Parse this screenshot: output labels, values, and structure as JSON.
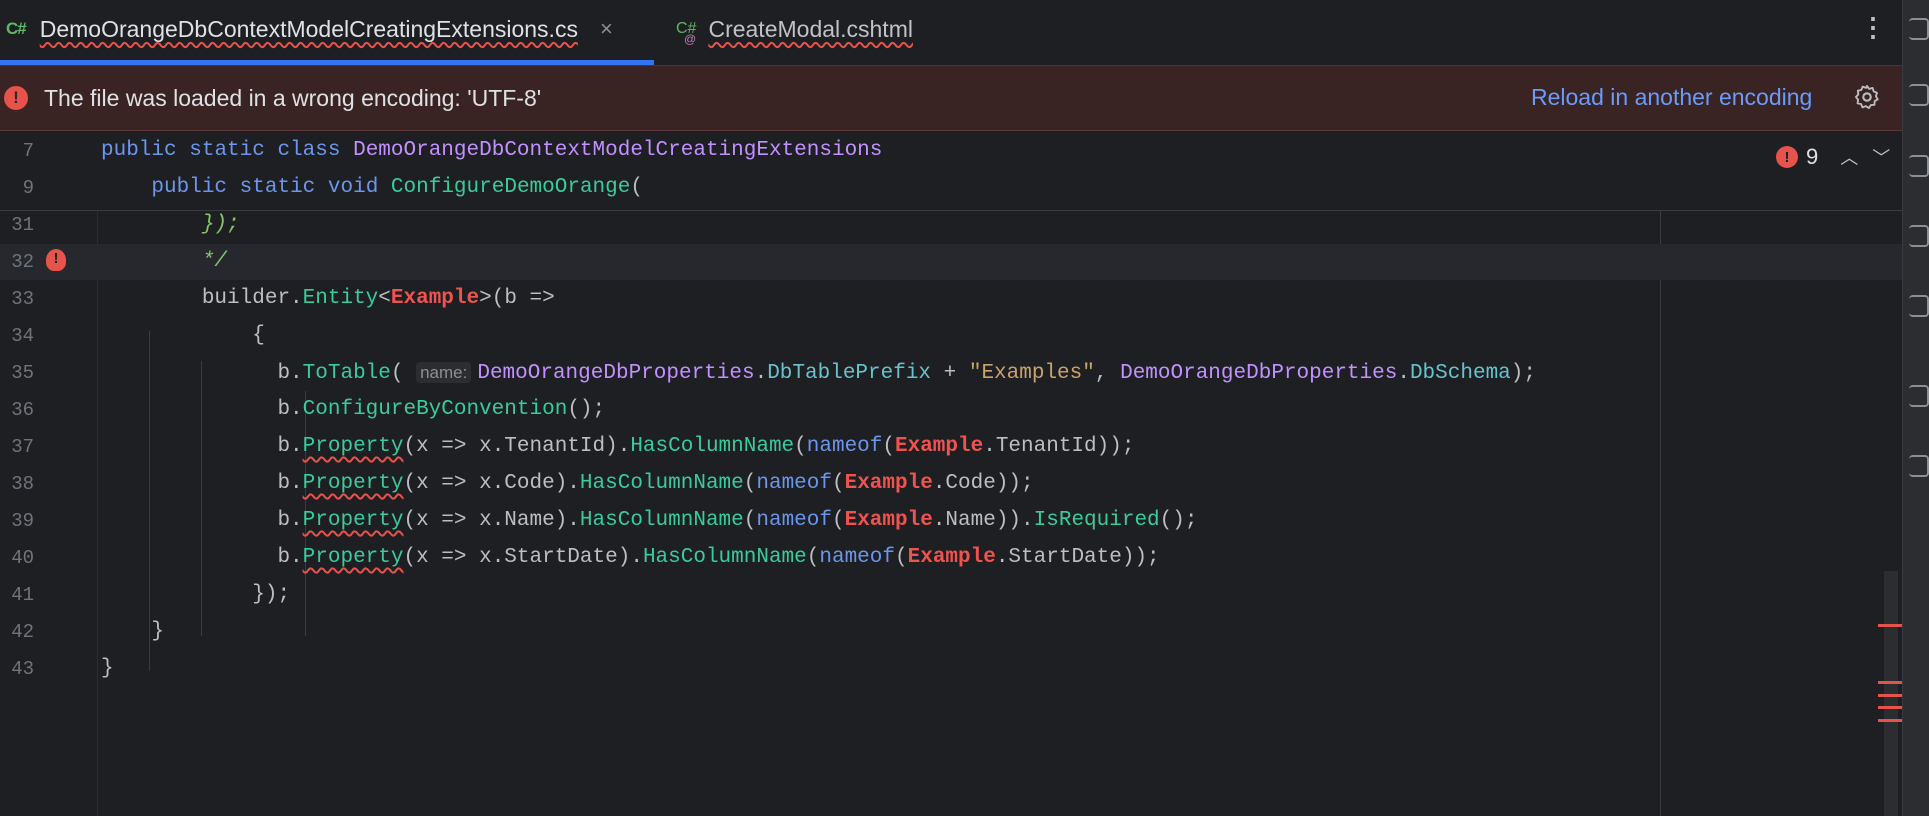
{
  "tabs": [
    {
      "lang": "C#",
      "name": "DemoOrangeDbContextModelCreatingExtensions.cs",
      "close": "×",
      "active": true
    },
    {
      "lang": "C#",
      "lang_sub": "@",
      "name": "CreateModal.cshtml",
      "active": false
    }
  ],
  "banner": {
    "icon": "!",
    "message": "The file was loaded in a wrong encoding: 'UTF-8'",
    "action": "Reload in another encoding"
  },
  "inspections": {
    "count": "9",
    "icon": "!"
  },
  "gutter": {
    "bulb_line": "32"
  },
  "lines": {
    "l7": "7",
    "l9": "9",
    "l31": "31",
    "l32": "32",
    "l33": "33",
    "l34": "34",
    "l35": "35",
    "l36": "36",
    "l37": "37",
    "l38": "38",
    "l39": "39",
    "l40": "40",
    "l41": "41",
    "l42": "42",
    "l43": "43"
  },
  "code": {
    "public": "public",
    "static": "static",
    "class": "class",
    "void": "void",
    "class_name": "DemoOrangeDbContextModelCreatingExtensions",
    "method_name": "ConfigureDemoOrange",
    "open_paren": "(",
    "l31": "});",
    "l32": "*/",
    "builder": "builder.",
    "entity": "Entity",
    "lt": "<",
    "example": "Example",
    "gt_lambda": ">(b =>",
    "open_brace": "{",
    "b_dot": "b.",
    "to_table": "ToTable",
    "paren_open": "(",
    "hint_name": "name:",
    "props_class": "DemoOrangeDbProperties",
    "dot": ".",
    "table_prefix": "DbTablePrefix",
    "plus": " + ",
    "examples_str": "\"Examples\"",
    "comma": ", ",
    "db_schema": "DbSchema",
    "end_stmt": ");",
    "configure": "ConfigureByConvention",
    "call_end": "();",
    "property": "Property",
    "nameof": "nameof",
    "has_column": "HasColumnName",
    "is_required": "IsRequired",
    "l37_lambda": "(x => x.TenantId).",
    "l37_member": ".TenantId));",
    "l38_lambda": "(x => x.Code).",
    "l38_member": ".Code));",
    "l39_lambda": "(x => x.Name).",
    "l39_member": ".Name)).",
    "l40_lambda": "(x => x.StartDate).",
    "l40_member": ".StartDate));",
    "l41": "});",
    "close_brace": "}"
  },
  "colors": {
    "error": "#e5534b",
    "accent": "#3574f0",
    "keyword": "#6c95eb",
    "method": "#39cc9b",
    "class": "#c191ff",
    "string": "#c9a26d",
    "comment": "#85c46c"
  }
}
